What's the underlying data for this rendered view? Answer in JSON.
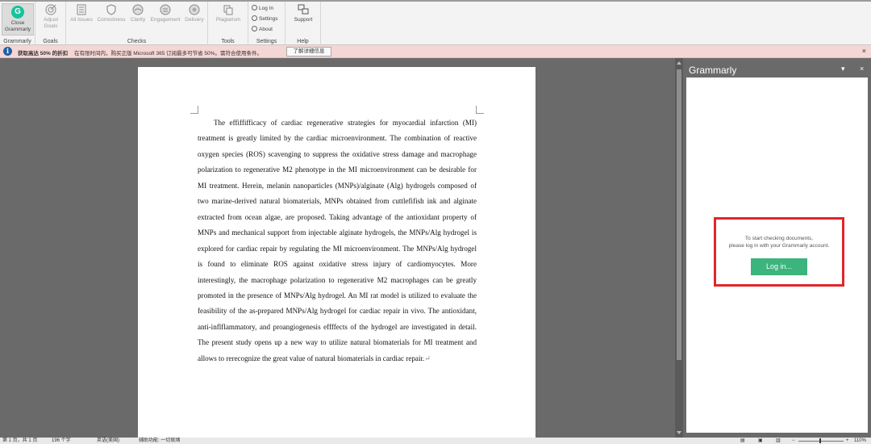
{
  "ribbon": {
    "groups": {
      "grammarly": "Grammarly",
      "goals": "Goals",
      "checks": "Checks",
      "tools": "Tools",
      "settings": "Settings",
      "help": "Help"
    },
    "close_grammarly_line1": "Close",
    "close_grammarly_line2": "Grammarly",
    "adjust_goals_line1": "Adjust",
    "adjust_goals_line2": "Goals",
    "all_issues": "All Issues",
    "correctness": "Correctness",
    "clarity": "Clarity",
    "engagement": "Engagement",
    "delivery": "Delivery",
    "plagiarism": "Plagiarism",
    "log_in": "Log In",
    "settings": "Settings",
    "about": "About",
    "support": "Support",
    "brand_color": "#15c39a"
  },
  "infobar": {
    "bold_text": "获取高达 50% 的折扣",
    "message": "在有限时间内，购买正版 Microsoft 365 订阅最多可节省 50%。需符合使用条件。",
    "button": "了解详细信息",
    "close": "×"
  },
  "document": {
    "paragraph": "The effiffifficacy of cardiac regenerative strategies for myocardial infarction (MI) treatment is greatly limited by the cardiac microenvironment. The combination of reactive oxygen species (ROS) scavenging to suppress the oxidative stress damage and macrophage polarization to regenerative M2 phenotype in the MI microenvironment can be desirable for MI treatment. Herein, melanin nanoparticles (MNPs)/alginate (Alg) hydrogels composed of two marine-derived natural biomaterials, MNPs obtained from cuttlefifish ink and alginate extracted from ocean algae, are proposed. Taking advantage of the antioxidant property of MNPs and mechanical support from injectable alginate hydrogels, the MNPs/Alg hydrogel is explored for cardiac repair by regulating the MI microenvironment. The MNPs/Alg hydrogel is found to eliminate ROS against oxidative stress injury of cardiomyocytes. More interestingly, the macrophage polarization to regenerative M2 macrophages can be greatly promoted in the presence of MNPs/Alg hydrogel. An MI rat model is utilized to evaluate the feasibility of the as-prepared MNPs/Alg hydrogel for cardiac repair in vivo. The antioxidant, anti-inflflammatory, and proangiogenesis effffects of the hydrogel are investigated in detail. The present study opens up a new way to utilize natural biomaterials for MI treatment and allows to rerecognize the great value of natural biomaterials in cardiac repair.",
    "paragraph_mark": "↵"
  },
  "grammarly_pane": {
    "title": "Grammarly",
    "dropdown": "▾",
    "close": "×",
    "login_line1": "To start checking documents,",
    "login_line2": "please log in with your Grammarly account.",
    "login_button": "Log in...",
    "button_color": "#3cb47d",
    "highlight_color": "#e0262b"
  },
  "statusbar": {
    "page": "第 1 页，共 1 页",
    "words": "196 个字",
    "language": "英语(美国)",
    "accessibility": "辅助功能: 一切就绪",
    "zoom": "110%"
  }
}
